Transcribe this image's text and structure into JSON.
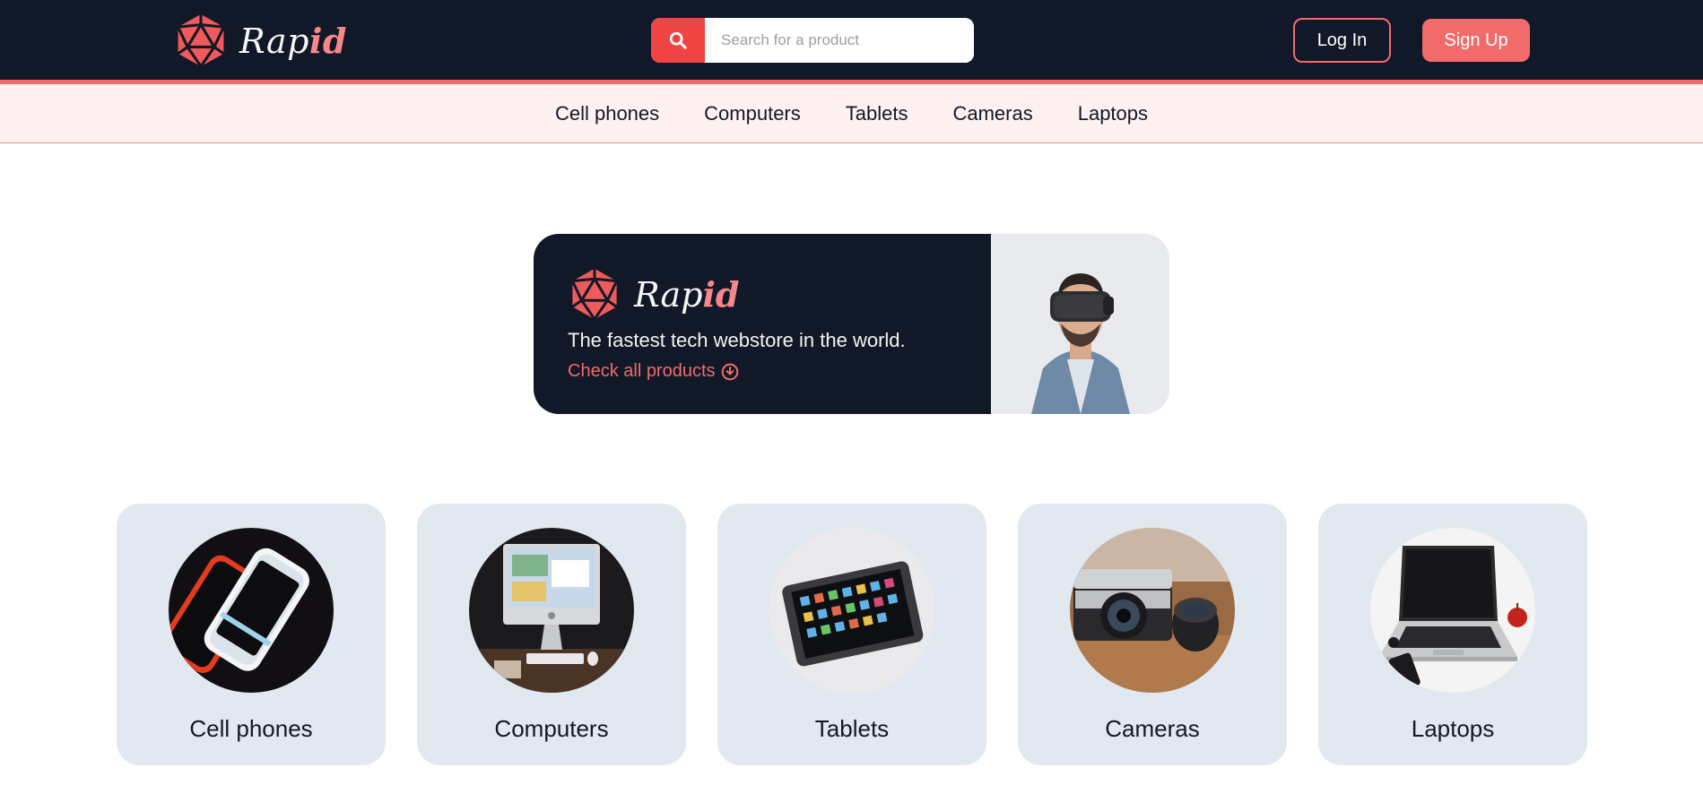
{
  "header": {
    "brand": {
      "prefix": "Rap",
      "accent": "id"
    },
    "search": {
      "placeholder": "Search for a product"
    },
    "login_label": "Log In",
    "signup_label": "Sign Up"
  },
  "nav": {
    "items": [
      {
        "label": "Cell phones"
      },
      {
        "label": "Computers"
      },
      {
        "label": "Tablets"
      },
      {
        "label": "Cameras"
      },
      {
        "label": "Laptops"
      }
    ]
  },
  "hero": {
    "brand": {
      "prefix": "Rap",
      "accent": "id"
    },
    "tagline": "The fastest tech webstore in the world.",
    "link_label": "Check all products"
  },
  "categories": [
    {
      "label": "Cell phones"
    },
    {
      "label": "Computers"
    },
    {
      "label": "Tablets"
    },
    {
      "label": "Cameras"
    },
    {
      "label": "Laptops"
    }
  ],
  "colors": {
    "dark": "#111827",
    "accent": "#f26b6b",
    "nav_bg": "#fff1f1",
    "card_bg": "#e2e8f0"
  }
}
